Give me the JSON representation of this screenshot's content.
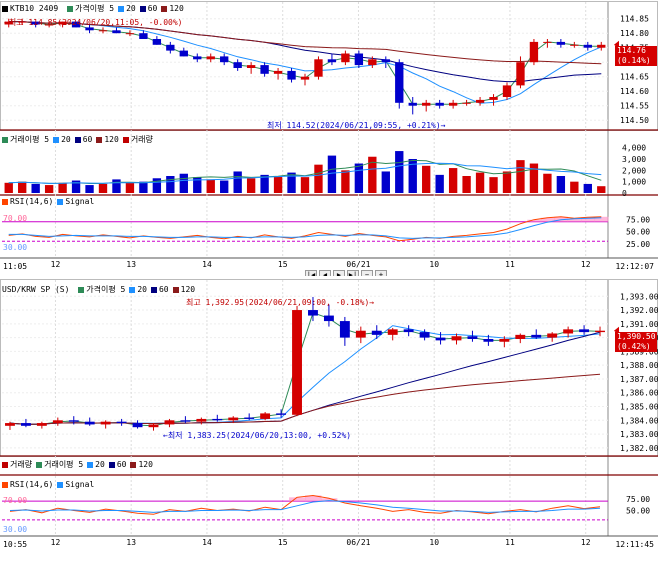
{
  "top": {
    "symbol": "KTB10 2409",
    "legend": [
      {
        "label": "가격이평 5",
        "color": "#2e8b57"
      },
      {
        "label": "20",
        "color": "#1e90ff"
      },
      {
        "label": "60",
        "color": "#000080"
      },
      {
        "label": "120",
        "color": "#8b1a1a"
      }
    ],
    "high_annotation": "←최고 114.85(2024/06/20,11:05, -0.00%)",
    "low_annotation": "최저 114.52(2024/06/21,09:55, +0.21%)→",
    "price_label": "114.76",
    "price_change": "(0.14%)",
    "price_ticks": [
      "114.85",
      "114.80",
      "114.75",
      "114.70",
      "114.65",
      "114.60",
      "114.55",
      "114.50"
    ],
    "price_axis": [
      114.48,
      114.88
    ],
    "volume_legend": [
      {
        "label": "거래이평 5",
        "color": "#2e8b57"
      },
      {
        "label": "20",
        "color": "#1e90ff"
      },
      {
        "label": "60",
        "color": "#000080"
      },
      {
        "label": "120",
        "color": "#8b1a1a"
      },
      {
        "label": "거래량",
        "color": "#c00000"
      }
    ],
    "volume_ticks": [
      "4,000",
      "3,000",
      "2,000",
      "1,000",
      "0"
    ],
    "rsi_legend": [
      {
        "label": "RSI(14,6)",
        "color": "#ff4500"
      },
      {
        "label": "Signal",
        "color": "#1e90ff"
      }
    ],
    "rsi_ticks": [
      "75.00",
      "50.00",
      "25.00"
    ],
    "rsi_upper": "70.00",
    "rsi_lower": "30.00",
    "date_labels": [
      "12",
      "13",
      "14",
      "15",
      "06/21",
      "10",
      "11",
      "12"
    ],
    "time_start": "11:05",
    "time_end": "12:12:07"
  },
  "bottom": {
    "symbol": "USD/KRW SP (S)",
    "legend": [
      {
        "label": "가격이평 5",
        "color": "#2e8b57"
      },
      {
        "label": "20",
        "color": "#1e90ff"
      },
      {
        "label": "60",
        "color": "#000080"
      },
      {
        "label": "120",
        "color": "#8b1a1a"
      }
    ],
    "high_annotation": "최고 1,392.95(2024/06/21,09:00, -0.18%)→",
    "low_annotation": "←최저 1,383.25(2024/06/20,13:00, +0.52%)",
    "price_label": "1,390.50",
    "price_change": "(0.42%)",
    "price_ticks": [
      "1,393.00",
      "1,392.00",
      "1,391.00",
      "1,390.00",
      "1,389.00",
      "1,388.00",
      "1,387.00",
      "1,386.00",
      "1,385.00",
      "1,384.00",
      "1,383.00",
      "1,382.00"
    ],
    "price_axis": [
      1381.7,
      1393.6
    ],
    "volume_legend": [
      {
        "label": "거래량",
        "color": "#c00000"
      },
      {
        "label": "거래이평 5",
        "color": "#2e8b57"
      },
      {
        "label": "20",
        "color": "#1e90ff"
      },
      {
        "label": "60",
        "color": "#000080"
      },
      {
        "label": "120",
        "color": "#8b1a1a"
      }
    ],
    "rsi_legend": [
      {
        "label": "RSI(14,6)",
        "color": "#ff4500"
      },
      {
        "label": "Signal",
        "color": "#1e90ff"
      }
    ],
    "rsi_ticks": [
      "75.00",
      "50.00"
    ],
    "rsi_upper": "70.00",
    "rsi_lower": "30.00",
    "date_labels": [
      "12",
      "13",
      "14",
      "15",
      "06/21",
      "10",
      "11",
      "12"
    ],
    "time_start": "10:55",
    "time_end": "12:11:45"
  },
  "chart_data": [
    {
      "type": "candlestick",
      "title": "KTB10 2409",
      "ylim": [
        114.48,
        114.88
      ],
      "ohlc": [
        [
          114.83,
          114.85,
          114.82,
          114.84
        ],
        [
          114.84,
          114.85,
          114.83,
          114.84
        ],
        [
          114.84,
          114.84,
          114.82,
          114.83
        ],
        [
          114.83,
          114.84,
          114.82,
          114.83
        ],
        [
          114.83,
          114.84,
          114.82,
          114.84
        ],
        [
          114.84,
          114.84,
          114.82,
          114.82
        ],
        [
          114.82,
          114.83,
          114.8,
          114.81
        ],
        [
          114.81,
          114.82,
          114.8,
          114.81
        ],
        [
          114.81,
          114.82,
          114.8,
          114.8
        ],
        [
          114.8,
          114.81,
          114.79,
          114.8
        ],
        [
          114.8,
          114.81,
          114.78,
          114.78
        ],
        [
          114.78,
          114.79,
          114.76,
          114.76
        ],
        [
          114.76,
          114.77,
          114.73,
          114.74
        ],
        [
          114.74,
          114.75,
          114.72,
          114.72
        ],
        [
          114.72,
          114.73,
          114.7,
          114.71
        ],
        [
          114.71,
          114.73,
          114.7,
          114.72
        ],
        [
          114.72,
          114.73,
          114.69,
          114.7
        ],
        [
          114.7,
          114.71,
          114.67,
          114.68
        ],
        [
          114.68,
          114.7,
          114.66,
          114.69
        ],
        [
          114.69,
          114.7,
          114.65,
          114.66
        ],
        [
          114.66,
          114.68,
          114.64,
          114.67
        ],
        [
          114.67,
          114.68,
          114.63,
          114.64
        ],
        [
          114.64,
          114.66,
          114.62,
          114.65
        ],
        [
          114.65,
          114.72,
          114.64,
          114.71
        ],
        [
          114.71,
          114.73,
          114.69,
          114.7
        ],
        [
          114.7,
          114.74,
          114.69,
          114.73
        ],
        [
          114.73,
          114.74,
          114.68,
          114.69
        ],
        [
          114.69,
          114.72,
          114.68,
          114.71
        ],
        [
          114.71,
          114.72,
          114.68,
          114.7
        ],
        [
          114.7,
          114.71,
          114.54,
          114.56
        ],
        [
          114.56,
          114.58,
          114.52,
          114.55
        ],
        [
          114.55,
          114.57,
          114.53,
          114.56
        ],
        [
          114.56,
          114.57,
          114.54,
          114.55
        ],
        [
          114.55,
          114.57,
          114.54,
          114.56
        ],
        [
          114.56,
          114.57,
          114.55,
          114.56
        ],
        [
          114.56,
          114.58,
          114.55,
          114.57
        ],
        [
          114.57,
          114.59,
          114.55,
          114.58
        ],
        [
          114.58,
          114.63,
          114.57,
          114.62
        ],
        [
          114.62,
          114.72,
          114.61,
          114.7
        ],
        [
          114.7,
          114.78,
          114.69,
          114.77
        ],
        [
          114.77,
          114.78,
          114.75,
          114.77
        ],
        [
          114.77,
          114.78,
          114.75,
          114.76
        ],
        [
          114.76,
          114.77,
          114.75,
          114.76
        ],
        [
          114.76,
          114.77,
          114.74,
          114.75
        ],
        [
          114.75,
          114.77,
          114.74,
          114.76
        ]
      ],
      "volume": [
        900,
        1000,
        800,
        700,
        900,
        1100,
        700,
        800,
        1200,
        900,
        1000,
        1300,
        1500,
        1700,
        1400,
        1200,
        1100,
        1900,
        1300,
        1600,
        1500,
        1800,
        1400,
        2500,
        3300,
        2000,
        2600,
        3200,
        1900,
        3700,
        3000,
        2400,
        1600,
        2200,
        1500,
        1800,
        1400,
        1900,
        2900,
        2600,
        1700,
        1500,
        1000,
        800,
        600
      ],
      "rsi": [
        42,
        45,
        40,
        38,
        44,
        41,
        39,
        43,
        40,
        37,
        41,
        38,
        36,
        39,
        42,
        38,
        35,
        40,
        37,
        43,
        39,
        36,
        41,
        48,
        44,
        40,
        46,
        42,
        39,
        31,
        34,
        38,
        36,
        40,
        42,
        45,
        48,
        55,
        66,
        74,
        78,
        80,
        77,
        79,
        80
      ],
      "signal": [
        44,
        44,
        42,
        40,
        41,
        42,
        41,
        41,
        41,
        40,
        40,
        39,
        38,
        38,
        39,
        39,
        38,
        38,
        38,
        39,
        39,
        38,
        39,
        42,
        43,
        42,
        43,
        43,
        41,
        37,
        36,
        37,
        37,
        38,
        39,
        41,
        43,
        47,
        54,
        62,
        69,
        74,
        76,
        77,
        78
      ]
    },
    {
      "type": "candlestick",
      "title": "USD/KRW SP (S)",
      "ylim": [
        1381.7,
        1393.6
      ],
      "ohlc": [
        [
          1383.6,
          1383.9,
          1383.3,
          1383.8
        ],
        [
          1383.8,
          1384.1,
          1383.5,
          1383.6
        ],
        [
          1383.6,
          1383.9,
          1383.4,
          1383.8
        ],
        [
          1383.8,
          1384.2,
          1383.6,
          1384.0
        ],
        [
          1384.0,
          1384.3,
          1383.7,
          1383.9
        ],
        [
          1383.9,
          1384.2,
          1383.6,
          1383.7
        ],
        [
          1383.7,
          1384.0,
          1383.4,
          1383.9
        ],
        [
          1383.9,
          1384.1,
          1383.6,
          1383.8
        ],
        [
          1383.8,
          1384.0,
          1383.4,
          1383.5
        ],
        [
          1383.5,
          1383.8,
          1383.25,
          1383.7
        ],
        [
          1383.7,
          1384.1,
          1383.5,
          1384.0
        ],
        [
          1384.0,
          1384.3,
          1383.8,
          1383.9
        ],
        [
          1383.9,
          1384.2,
          1383.7,
          1384.1
        ],
        [
          1384.1,
          1384.4,
          1383.9,
          1384.0
        ],
        [
          1384.0,
          1384.3,
          1383.8,
          1384.2
        ],
        [
          1384.2,
          1384.5,
          1384.0,
          1384.1
        ],
        [
          1384.1,
          1384.6,
          1384.0,
          1384.5
        ],
        [
          1384.5,
          1384.8,
          1384.2,
          1384.4
        ],
        [
          1384.4,
          1392.3,
          1384.3,
          1392.0
        ],
        [
          1392.0,
          1392.95,
          1391.2,
          1391.6
        ],
        [
          1391.6,
          1392.4,
          1390.8,
          1391.2
        ],
        [
          1391.2,
          1391.5,
          1389.4,
          1390.0
        ],
        [
          1390.0,
          1390.8,
          1389.6,
          1390.5
        ],
        [
          1390.5,
          1390.9,
          1389.9,
          1390.2
        ],
        [
          1390.2,
          1390.7,
          1389.8,
          1390.6
        ],
        [
          1390.6,
          1390.9,
          1390.1,
          1390.4
        ],
        [
          1390.4,
          1390.6,
          1389.8,
          1390.0
        ],
        [
          1390.0,
          1390.4,
          1389.5,
          1389.8
        ],
        [
          1389.8,
          1390.3,
          1389.5,
          1390.1
        ],
        [
          1390.1,
          1390.5,
          1389.7,
          1389.9
        ],
        [
          1389.9,
          1390.2,
          1389.4,
          1389.7
        ],
        [
          1389.7,
          1390.1,
          1389.3,
          1389.9
        ],
        [
          1389.9,
          1390.3,
          1389.6,
          1390.2
        ],
        [
          1390.2,
          1390.6,
          1389.9,
          1390.0
        ],
        [
          1390.0,
          1390.4,
          1389.7,
          1390.3
        ],
        [
          1390.3,
          1390.8,
          1390.0,
          1390.6
        ],
        [
          1390.6,
          1390.9,
          1390.2,
          1390.4
        ],
        [
          1390.4,
          1390.8,
          1390.1,
          1390.5
        ]
      ],
      "rsi": [
        48,
        52,
        45,
        55,
        50,
        46,
        53,
        49,
        44,
        42,
        52,
        48,
        55,
        50,
        53,
        49,
        57,
        52,
        78,
        82,
        76,
        66,
        60,
        55,
        48,
        52,
        46,
        44,
        50,
        47,
        43,
        48,
        52,
        47,
        55,
        60,
        54,
        58
      ],
      "signal": [
        50,
        51,
        49,
        51,
        51,
        49,
        50,
        50,
        48,
        46,
        48,
        48,
        50,
        50,
        51,
        50,
        52,
        52,
        60,
        68,
        71,
        69,
        66,
        62,
        57,
        55,
        52,
        49,
        49,
        48,
        46,
        47,
        48,
        48,
        50,
        53,
        53,
        55
      ]
    }
  ]
}
